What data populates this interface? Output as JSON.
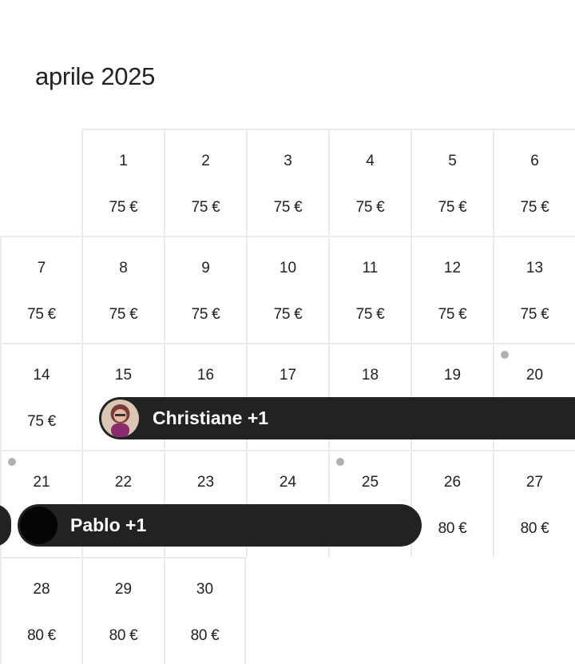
{
  "calendar": {
    "month_title": "aprile 2025",
    "weeks": [
      [
        null,
        {
          "day": "1",
          "price": "75 €"
        },
        {
          "day": "2",
          "price": "75 €"
        },
        {
          "day": "3",
          "price": "75 €"
        },
        {
          "day": "4",
          "price": "75 €"
        },
        {
          "day": "5",
          "price": "75 €"
        },
        {
          "day": "6",
          "price": "75 €"
        }
      ],
      [
        {
          "day": "7",
          "price": "75 €"
        },
        {
          "day": "8",
          "price": "75 €"
        },
        {
          "day": "9",
          "price": "75 €"
        },
        {
          "day": "10",
          "price": "75 €"
        },
        {
          "day": "11",
          "price": "75 €"
        },
        {
          "day": "12",
          "price": "75 €"
        },
        {
          "day": "13",
          "price": "75 €"
        }
      ],
      [
        {
          "day": "14",
          "price": "75 €"
        },
        {
          "day": "15",
          "price": ""
        },
        {
          "day": "16",
          "price": ""
        },
        {
          "day": "17",
          "price": ""
        },
        {
          "day": "18",
          "price": ""
        },
        {
          "day": "19",
          "price": ""
        },
        {
          "day": "20",
          "price": "",
          "dot": true
        }
      ],
      [
        {
          "day": "21",
          "price": "",
          "dot": true
        },
        {
          "day": "22",
          "price": ""
        },
        {
          "day": "23",
          "price": ""
        },
        {
          "day": "24",
          "price": ""
        },
        {
          "day": "25",
          "price": "",
          "dot": true
        },
        {
          "day": "26",
          "price": "80 €"
        },
        {
          "day": "27",
          "price": "80 €"
        }
      ],
      [
        {
          "day": "28",
          "price": "80 €"
        },
        {
          "day": "29",
          "price": "80 €"
        },
        {
          "day": "30",
          "price": "80 €"
        },
        null,
        null,
        null,
        null
      ]
    ],
    "reservations": [
      {
        "guest_label": "Christiane +1",
        "avatar": "photo"
      },
      {
        "guest_label": "Pablo +1",
        "avatar": "dark"
      }
    ]
  },
  "colors": {
    "reservation_bar": "#222222",
    "grid_line": "#ebebeb",
    "dot": "#b0b0b0"
  }
}
